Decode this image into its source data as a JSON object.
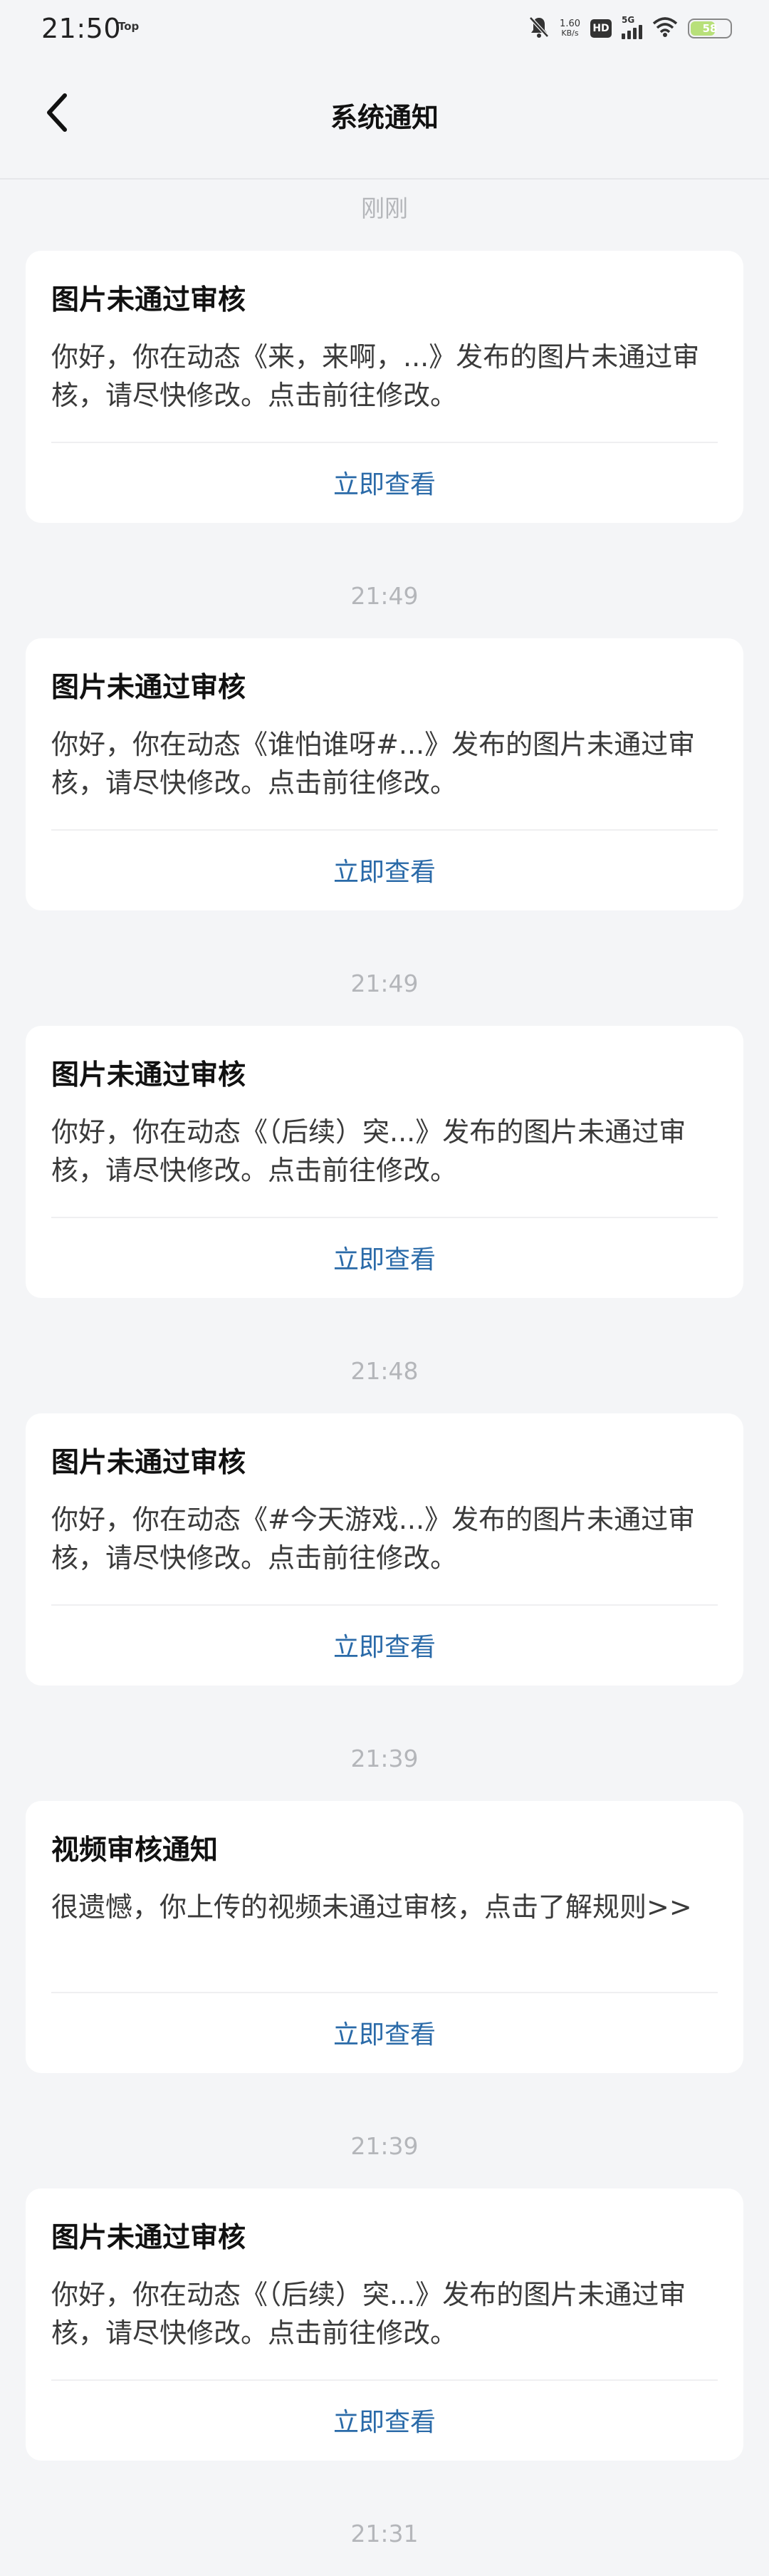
{
  "status_bar": {
    "time": "21:50",
    "top_label": "Top",
    "net_speed_value": "1.60",
    "net_speed_unit": "KB/s",
    "hd": "HD",
    "signal_label": "5G",
    "battery": "58",
    "battery_color": "#b8e07a"
  },
  "header": {
    "title": "系统通知",
    "back_icon": "back-arrow-icon"
  },
  "notifications": [
    {
      "time": "刚刚",
      "title": "图片未通过审核",
      "body": "你好，你在动态《来，来啊，...》发布的图片未通过审核，请尽快修改。点击前往修改。",
      "action": "立即查看"
    },
    {
      "time": "21:49",
      "title": "图片未通过审核",
      "body": "你好，你在动态《谁怕谁呀#...》发布的图片未通过审核，请尽快修改。点击前往修改。",
      "action": "立即查看"
    },
    {
      "time": "21:49",
      "title": "图片未通过审核",
      "body": "你好，你在动态《（后续）突...》发布的图片未通过审核，请尽快修改。点击前往修改。",
      "action": "立即查看"
    },
    {
      "time": "21:48",
      "title": "图片未通过审核",
      "body": "你好，你在动态《#今天游戏...》发布的图片未通过审核，请尽快修改。点击前往修改。",
      "action": "立即查看"
    },
    {
      "time": "21:39",
      "title": "视频审核通知",
      "body": "很遗憾，你上传的视频未通过审核，点击了解规则>>",
      "action": "立即查看"
    },
    {
      "time": "21:39",
      "title": "图片未通过审核",
      "body": "你好，你在动态《（后续）突...》发布的图片未通过审核，请尽快修改。点击前往修改。",
      "action": "立即查看"
    },
    {
      "time": "21:31"
    }
  ],
  "colors": {
    "background": "#f4f5f7",
    "card": "#ffffff",
    "link": "#2a6aa8",
    "timestamp": "#b4b6ba"
  }
}
